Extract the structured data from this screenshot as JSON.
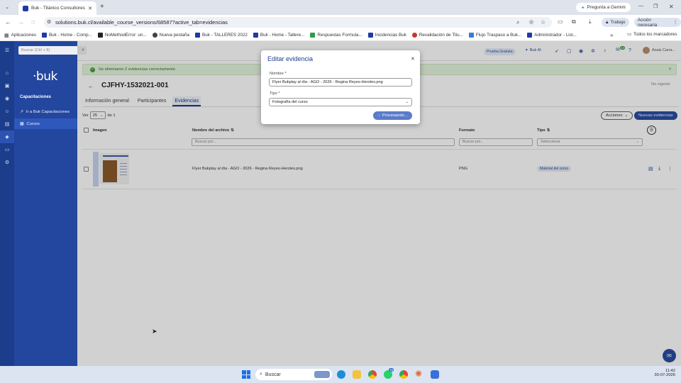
{
  "browser": {
    "tab_title": "Buk - Titánico Consultores",
    "url": "solutions.buk.cl/available_course_versions/68587?active_tab=evidencias",
    "gemini_label": "Pregunta a Gemini",
    "profile_label": "Trabajo",
    "action_label": "Acción necesaria",
    "bookmarks": [
      "Aplicaciones",
      "Buk - Home - Comp...",
      "NoMethodError: un...",
      "Nueva pestaña",
      "Buk - TALLERES 2022",
      "Buk - Home - Tallere...",
      "Respuestas Formula...",
      "Incidencias Buk",
      "Revalidación de Titu...",
      "Flujo Traspaso a Buk...",
      "Administrador - List..."
    ],
    "all_bookmarks_label": "Todos los marcadores"
  },
  "app": {
    "logo": "·buk",
    "search_placeholder": "Buscar (Ctrl + 8)",
    "trial_label": "Prueba Gratuita",
    "buk_ai_label": "Buk AI",
    "user_label": "Anais Carra...",
    "badge_count": "23",
    "sidebar": {
      "section": "Capacitaciones",
      "items": [
        "Ir a Buk Capacitaciones",
        "Cursos"
      ]
    }
  },
  "page": {
    "banner": "Se eliminaron 2 evidencias correctamente",
    "title": "CJFHY-1532021-001",
    "status": "No vigente",
    "tabs": [
      "Información general",
      "Participantes",
      "Evidencias"
    ],
    "ver_label": "Ver",
    "page_size": "25",
    "of_label": "de 1",
    "acciones_label": "Acciones",
    "new_button": "Nuevas evidencias",
    "columns": {
      "image": "Imagen",
      "filename": "Nombre del archivo",
      "format": "Formato",
      "type": "Tipo"
    },
    "filters": {
      "filename_placeholder": "Buscar por...",
      "format_placeholder": "Buscar por...",
      "type_placeholder": "Seleccionar"
    },
    "rows": [
      {
        "filename": "Flyer Bukplay al día - AGO - 2026 - Regina Reyes-Heroles.png",
        "format": "PNG",
        "type": "Material del curso"
      }
    ]
  },
  "modal": {
    "title": "Editar evidencia",
    "name_label": "Nombre *",
    "name_value": "Flyer Bukplay al día - AGO - 2026 - Regina Reyes-Heroles.png",
    "type_label": "Tipo *",
    "type_value": "Fotografía del curso",
    "processing_label": "Procesando..."
  },
  "taskbar": {
    "search_label": "Buscar",
    "time": "11:42",
    "date": "30-07-2026",
    "badges": [
      "16"
    ]
  },
  "colors": {
    "brand": "#23469e",
    "rail": "#1c3c8c",
    "primary_button": "#2a4ea3"
  }
}
